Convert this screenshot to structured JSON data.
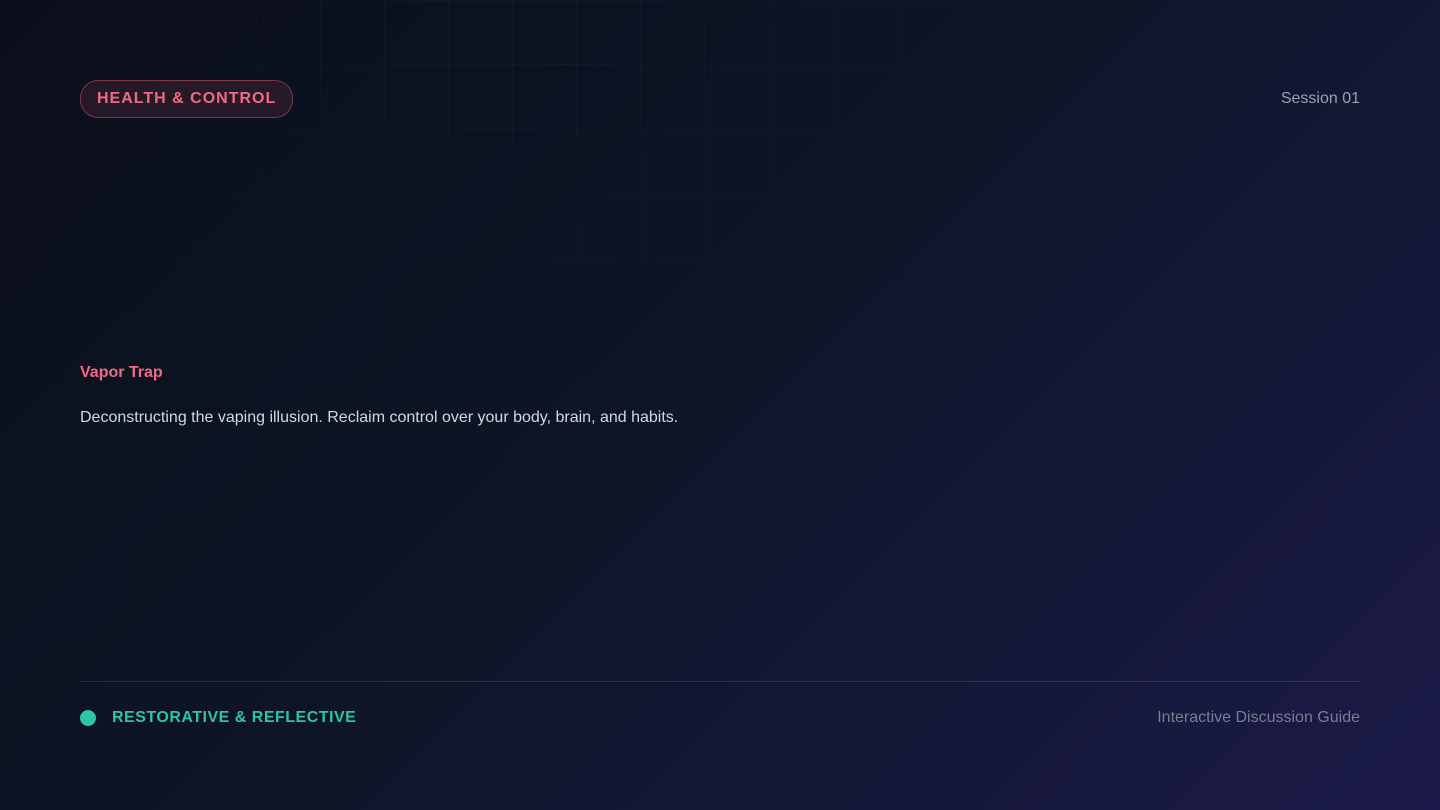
{
  "header": {
    "tag_label": "HEALTH & CONTROL",
    "session_label": "Session 01"
  },
  "hero": {
    "title": "Vapor Trap",
    "subtitle": "Deconstructing the vaping illusion. Reclaim control over your body, brain, and habits."
  },
  "footer": {
    "mood_label": "RESTORATIVE & REFLECTIVE",
    "guide_label": "Interactive Discussion Guide"
  },
  "colors": {
    "accent_pink": "#f06b82",
    "accent_teal": "#2ec4a6",
    "background_start": "#0b0f1b",
    "background_end": "#1c1a4a"
  },
  "icons": {
    "status": "status-dot-icon"
  }
}
